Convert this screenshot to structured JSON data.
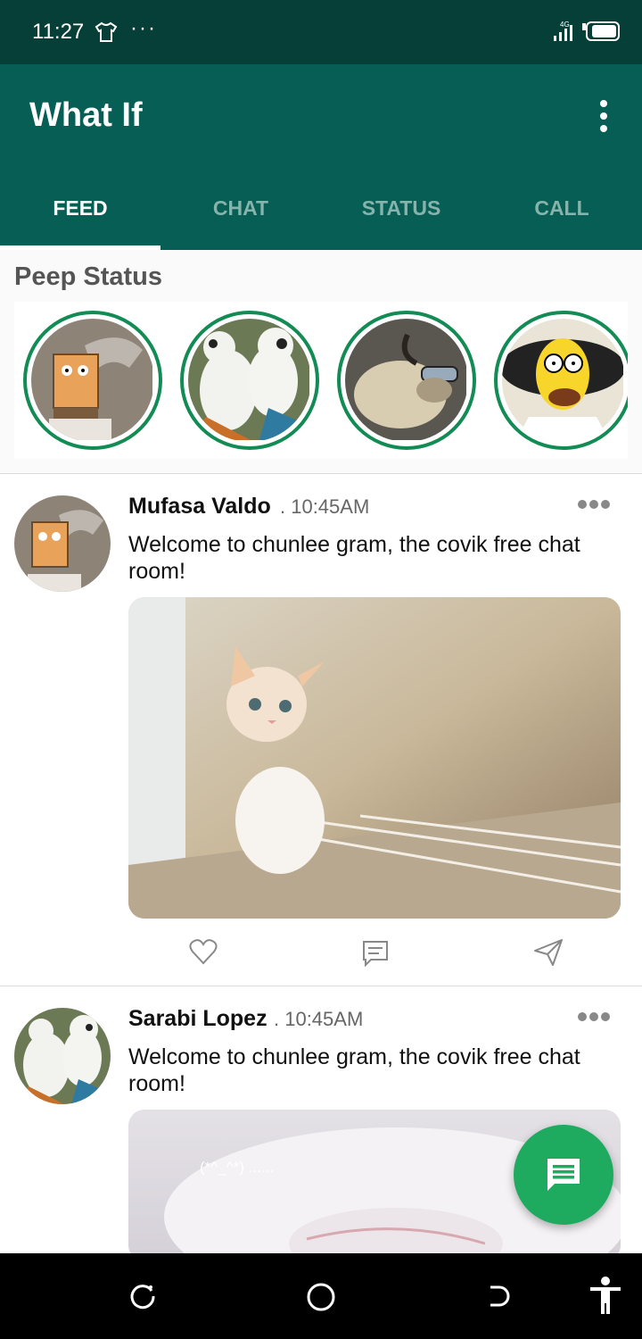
{
  "status_bar": {
    "time": "11:27",
    "overflow": "···",
    "network": "4G",
    "icons": [
      "tshirt-icon",
      "signal-icon",
      "battery-icon"
    ]
  },
  "app_bar": {
    "title": "What If",
    "menu_icon": "more-vert-icon"
  },
  "tabs": [
    {
      "label": "FEED",
      "active": true
    },
    {
      "label": "CHAT",
      "active": false
    },
    {
      "label": "STATUS",
      "active": false
    },
    {
      "label": "CALL",
      "active": false
    }
  ],
  "peep_status": {
    "title": "Peep Status",
    "items": [
      "spongebob-avatar",
      "panda-avatar",
      "fluffy-creature-avatar",
      "homer-avatar"
    ]
  },
  "posts": [
    {
      "name": "Mufasa Valdo",
      "time": ". 10:45AM",
      "text": "Welcome to chunlee gram, the covik free chat room!",
      "image": "kitten-photo",
      "actions": [
        "heart-icon",
        "comment-icon",
        "send-icon"
      ]
    },
    {
      "name": "Sarabi Lopez",
      "time": ". 10:45AM",
      "text": "Welcome to chunlee gram, the covik free chat room!",
      "image": "sleeping-cat-photo",
      "image_caption": "(*^_^*) ......"
    }
  ],
  "fab": {
    "icon": "chat-icon"
  },
  "nav_bar": {
    "icons": [
      "recent-apps-icon",
      "home-icon",
      "back-icon",
      "accessibility-icon"
    ]
  },
  "colors": {
    "primary": "#075e54",
    "status_bar": "#063f37",
    "accent": "#1eab5f",
    "ring": "#128c54"
  }
}
